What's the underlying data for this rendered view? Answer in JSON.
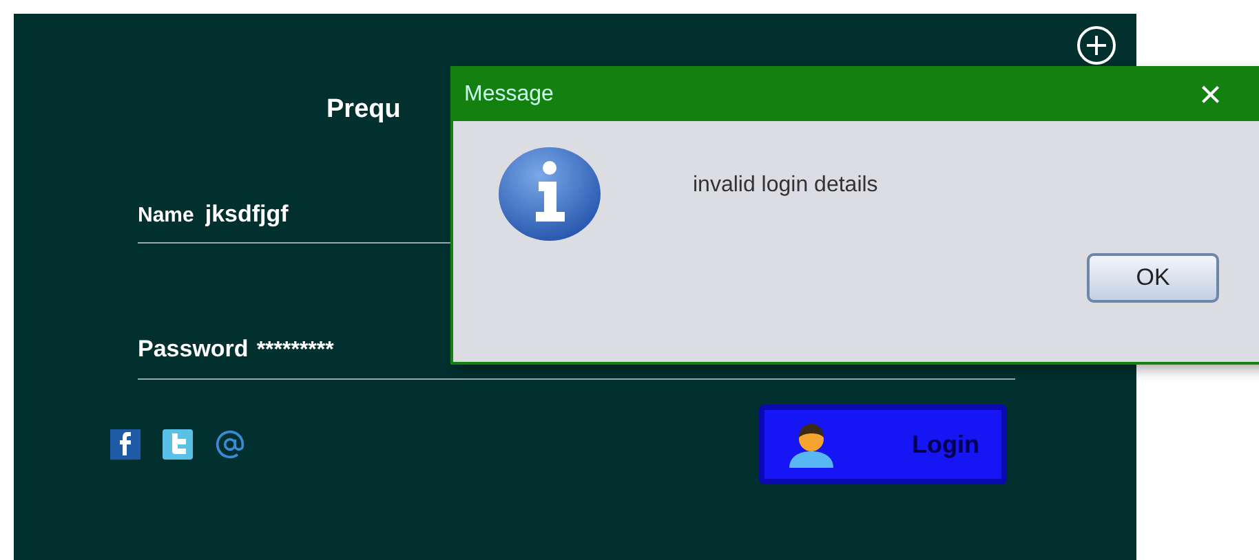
{
  "form": {
    "title": "Prequ",
    "name_label": "Name",
    "name_value": "jksdfjgf",
    "password_label": "Password",
    "password_value": "*********",
    "login_button": "Login"
  },
  "dialog": {
    "title": "Message",
    "close": "×",
    "message": "invalid login details",
    "button": "OK"
  }
}
